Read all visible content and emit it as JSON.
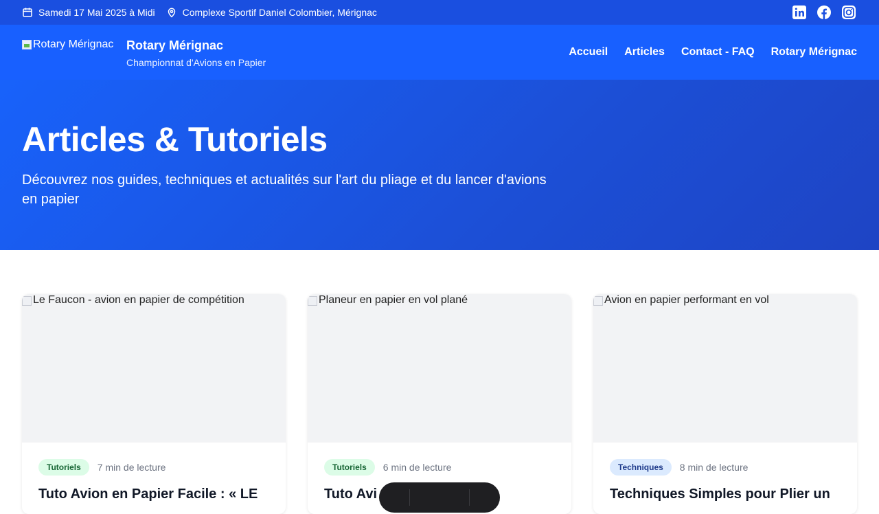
{
  "topbar": {
    "date": "Samedi 17 Mai 2025 à Midi",
    "location": "Complexe Sportif Daniel Colombier, Mérignac",
    "socials": [
      "linkedin-icon",
      "facebook-icon",
      "instagram-icon"
    ]
  },
  "header": {
    "logo_alt": "Rotary Mérignac",
    "title": "Rotary Mérignac",
    "subtitle": "Championnat d'Avions en Papier",
    "nav": [
      "Accueil",
      "Articles",
      "Contact - FAQ",
      "Rotary Mérignac"
    ]
  },
  "hero": {
    "title": "Articles & Tutoriels",
    "subtitle": "Découvrez nos guides, techniques et actualités sur l'art du pliage et du lancer d'avions en papier"
  },
  "cards": [
    {
      "image_alt": "Le Faucon - avion en papier de compétition",
      "category": "Tutoriels",
      "read_time": "7 min de lecture",
      "title": "Tuto Avion en Papier Facile : « LE"
    },
    {
      "image_alt": "Planeur en papier en vol plané",
      "category": "Tutoriels",
      "read_time": "6 min de lecture",
      "title": "Tuto Avi"
    },
    {
      "image_alt": "Avion en papier performant en vol",
      "category": "Techniques",
      "read_time": "8 min de lecture",
      "title": "Techniques Simples pour Plier un"
    }
  ],
  "colors": {
    "topbar": "#1a4fe0",
    "header": "#1860ff",
    "badge_tutoriels": "#dcfce7",
    "badge_techniques": "#dbeafe"
  }
}
